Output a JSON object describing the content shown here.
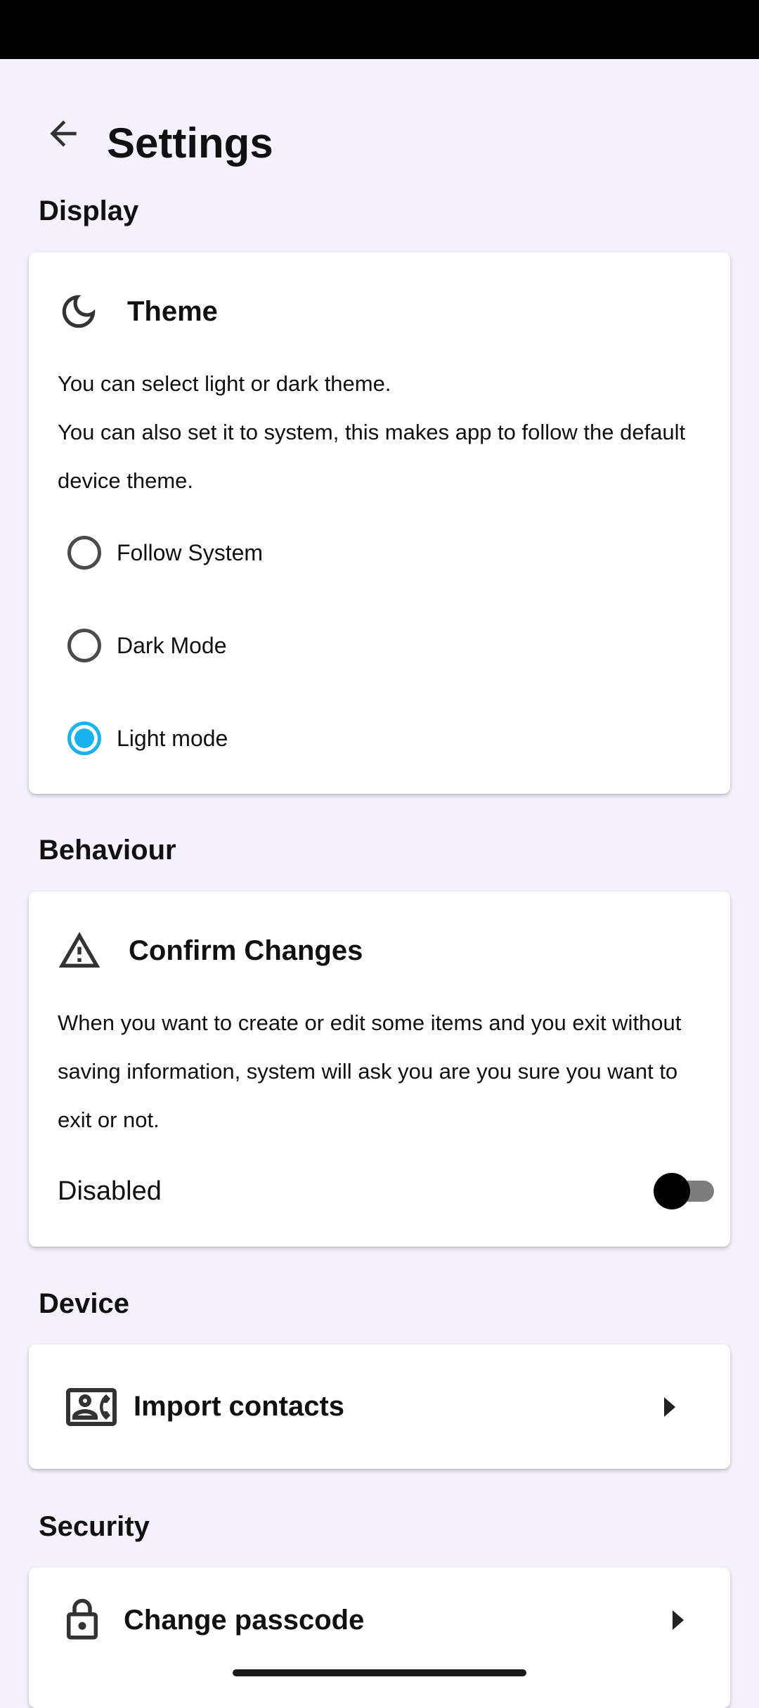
{
  "app_bar": {
    "title": "Settings",
    "back_icon": "arrow-back-icon"
  },
  "sections": {
    "display": {
      "label": "Display",
      "theme_card": {
        "icon": "moon-icon",
        "title": "Theme",
        "description": "You can select light or dark theme.\nYou can also set it to system, this makes app to follow the default device theme.",
        "options": [
          {
            "label": "Follow System",
            "selected": false
          },
          {
            "label": "Dark Mode",
            "selected": false
          },
          {
            "label": "Light mode",
            "selected": true
          }
        ]
      }
    },
    "behaviour": {
      "label": "Behaviour",
      "confirm_card": {
        "icon": "warning-icon",
        "title": "Confirm Changes",
        "description": "When you want to create or edit some items and you exit without saving information, system will ask you are you sure you want to exit or not.",
        "toggle_label": "Disabled",
        "toggle_on": false
      }
    },
    "device": {
      "label": "Device",
      "import_card": {
        "icon": "contact-card-icon",
        "label": "Import contacts",
        "chevron": "chevron-right-icon"
      }
    },
    "security": {
      "label": "Security",
      "passcode_card": {
        "icon": "lock-icon",
        "label": "Change passcode",
        "chevron": "chevron-right-icon"
      }
    }
  },
  "colors": {
    "background": "#f4f1fa",
    "accent": "#1bb3ee",
    "card": "#ffffff"
  }
}
